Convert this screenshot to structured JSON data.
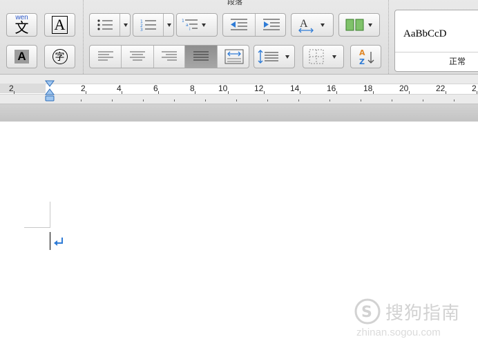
{
  "ribbon": {
    "paragraph_group_label": "段落",
    "phonetic_button": {
      "top_text": "wen",
      "main_char": "文"
    },
    "char_border_button": "A",
    "char_shading_button": "A",
    "enclose_char_button": "字",
    "style_gallery": {
      "preview_text": "AaBbCcD",
      "style_name": "正常"
    }
  },
  "ruler": {
    "labels": [
      "2",
      "2",
      "4",
      "6",
      "8",
      "10",
      "12",
      "14",
      "16",
      "18",
      "20",
      "22",
      "2"
    ]
  },
  "document": {
    "paragraph_mark": "↵"
  },
  "watermark": {
    "brand_cn": "搜狗指南",
    "brand_url": "zhinan.sogou.com"
  },
  "colors": {
    "ribbon_bg": "#dcdcdc",
    "accent_blue": "#2e7bd6",
    "pressed_button": "#9a9a9a"
  }
}
